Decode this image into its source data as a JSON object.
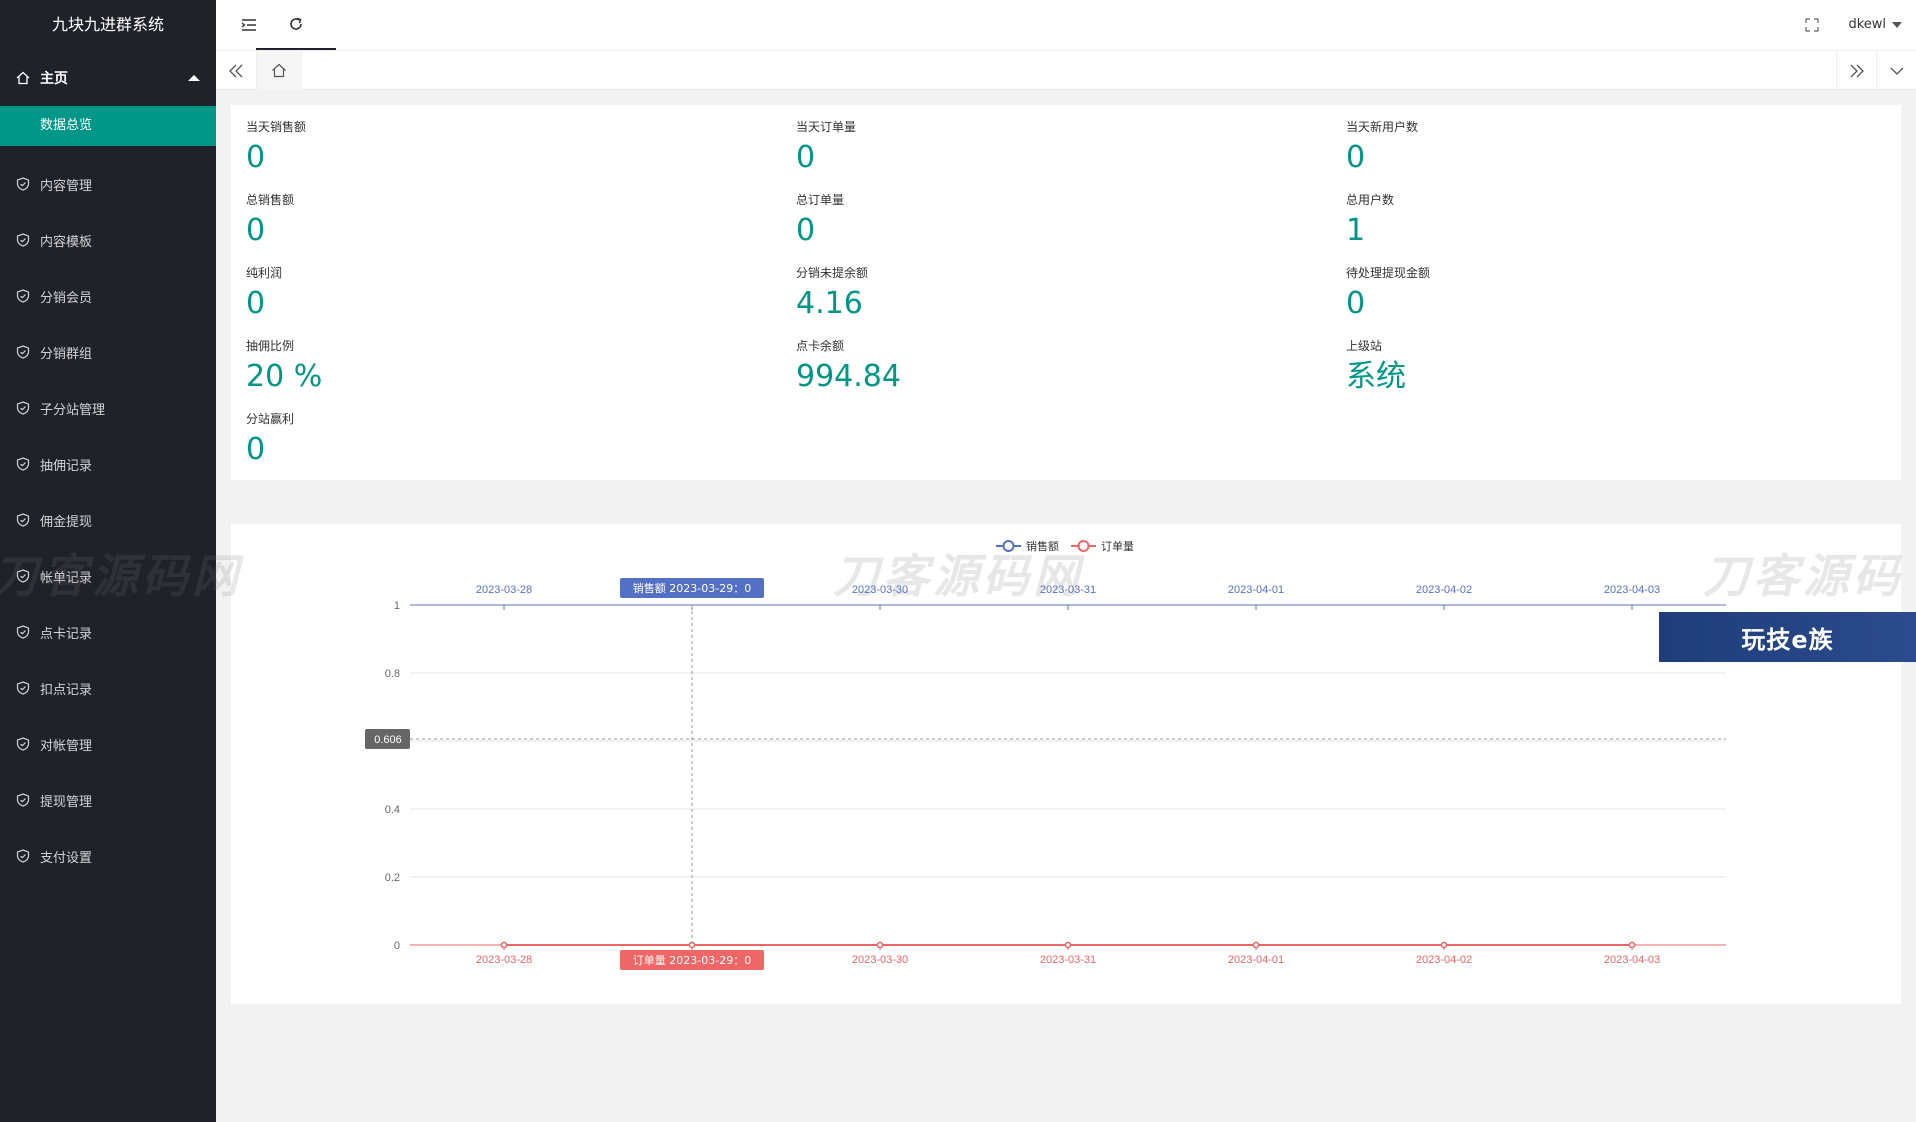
{
  "app": {
    "title": "九块九进群系统"
  },
  "sidebar": {
    "home": "主页",
    "sub": "数据总览",
    "items": [
      "内容管理",
      "内容模板",
      "分销会员",
      "分销群组",
      "子分站管理",
      "抽佣记录",
      "佣金提现",
      "帐单记录",
      "点卡记录",
      "扣点记录",
      "对帐管理",
      "提现管理",
      "支付设置"
    ]
  },
  "header": {
    "user": "dkewl"
  },
  "stats": [
    {
      "label": "当天销售额",
      "value": "0"
    },
    {
      "label": "当天订单量",
      "value": "0"
    },
    {
      "label": "当天新用户数",
      "value": "0"
    },
    {
      "label": "总销售额",
      "value": "0"
    },
    {
      "label": "总订单量",
      "value": "0"
    },
    {
      "label": "总用户数",
      "value": "1"
    },
    {
      "label": "纯利润",
      "value": "0"
    },
    {
      "label": "分销未提余额",
      "value": "4.16"
    },
    {
      "label": "待处理提现金额",
      "value": "0"
    },
    {
      "label": "抽佣比例",
      "value": "20 %"
    },
    {
      "label": "点卡余额",
      "value": "994.84"
    },
    {
      "label": "上级站",
      "value": "系统"
    },
    {
      "label": "分站赢利",
      "value": "0"
    }
  ],
  "chart_data": {
    "type": "line",
    "categories": [
      "2023-03-28",
      "2023-03-29",
      "2023-03-30",
      "2023-03-31",
      "2023-04-01",
      "2023-04-02",
      "2023-04-03"
    ],
    "series": [
      {
        "name": "销售额",
        "values": [
          0,
          0,
          0,
          0,
          0,
          0,
          0
        ],
        "color": "#5470c6"
      },
      {
        "name": "订单量",
        "values": [
          0,
          0,
          0,
          0,
          0,
          0,
          0
        ],
        "color": "#ee6666"
      }
    ],
    "ylim": [
      0,
      1
    ],
    "yticks": [
      "0",
      "0.2",
      "0.4",
      "0.6",
      "0.8",
      "1"
    ],
    "legend_position": "top-center",
    "grid": true,
    "tooltip": {
      "top_label": "销售额  2023-03-29：0",
      "bottom_label": "订单量  2023-03-29：0",
      "y_pointer": "0.606",
      "y_pointer_value": 0.606,
      "category_index": 1
    }
  },
  "watermarks": [
    "刀客源码网",
    "刀客源码网",
    "刀客源码"
  ],
  "ad": {
    "text": "玩技e族"
  },
  "colors": {
    "accent": "#009688",
    "sidebar": "#20222a",
    "sales": "#5470c6",
    "orders": "#ee6666"
  }
}
